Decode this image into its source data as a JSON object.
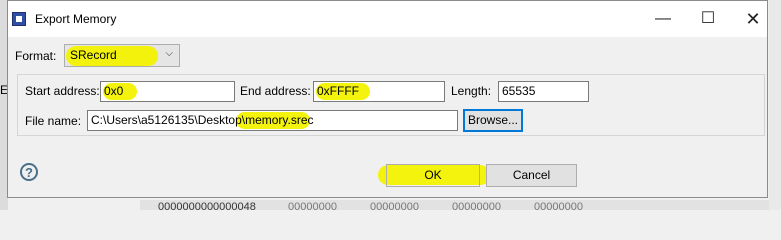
{
  "window": {
    "title": "Export Memory"
  },
  "background": {
    "left_label": "E",
    "bottom_cells": [
      "0000000000000048",
      "00000000",
      "00000000",
      "00000000",
      "00000000"
    ]
  },
  "titlebar_buttons": {
    "minimize": "—",
    "maximize": "☐",
    "close": "✕"
  },
  "format": {
    "label": "Format:",
    "value": "SRecord"
  },
  "start_address": {
    "label": "Start address:",
    "value": "0x0"
  },
  "end_address": {
    "label": "End address:",
    "value": "0xFFFF"
  },
  "length": {
    "label": "Length:",
    "value": "65535"
  },
  "file_name": {
    "label": "File name:",
    "value": "C:\\Users\\a5126135\\Desktop\\memory.srec"
  },
  "buttons": {
    "browse": "Browse...",
    "ok": "OK",
    "cancel": "Cancel",
    "help": "?"
  },
  "highlight_color": "#f2f200"
}
